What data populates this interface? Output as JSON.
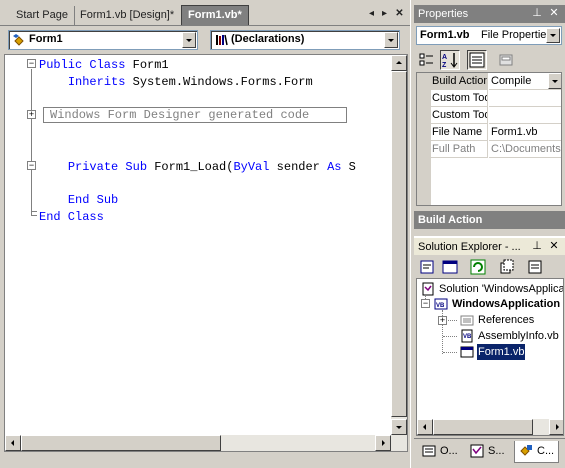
{
  "editor": {
    "tabs": [
      {
        "label": "Start Page",
        "active": false
      },
      {
        "label": "Form1.vb [Design]*",
        "active": false
      },
      {
        "label": "Form1.vb*",
        "active": true
      }
    ],
    "class_combo": "Form1",
    "method_combo": "(Declarations)",
    "code": {
      "line1": {
        "kw": "Public Class",
        "rest": " Form1"
      },
      "line2": {
        "kw": "Inherits",
        "rest": " System.Windows.Forms.Form"
      },
      "region": "Windows Form Designer generated code",
      "line4": {
        "kw1": "Private Sub",
        "mid": " Form1_Load(",
        "kw2": "ByVal",
        "mid2": " sender ",
        "kw3": "As",
        "tail": " S"
      },
      "line5": {
        "kw": "End Sub"
      },
      "line6": {
        "kw": "End Class"
      }
    },
    "keyword_color": "#0000ff"
  },
  "properties": {
    "title": "Properties",
    "object_name": "Form1.vb",
    "object_type": "File Propertie",
    "rows": [
      {
        "name": "Build Action",
        "value": "Compile",
        "selected": true,
        "disabled": false
      },
      {
        "name": "Custom Tool",
        "value": "",
        "selected": false,
        "disabled": false
      },
      {
        "name": "Custom Tool",
        "value": "",
        "selected": false,
        "disabled": false
      },
      {
        "name": "File Name",
        "value": "Form1.vb",
        "selected": false,
        "disabled": false
      },
      {
        "name": "Full Path",
        "value": "C:\\Documents a",
        "selected": false,
        "disabled": true
      }
    ],
    "description_title": "Build Action"
  },
  "solution_explorer": {
    "title": "Solution Explorer - ...",
    "nodes": {
      "solution": "Solution 'WindowsApplicat",
      "project": "WindowsApplication",
      "references": "References",
      "assembly": "AssemblyInfo.vb",
      "form": "Form1.vb"
    }
  },
  "bottom_tabs": [
    {
      "label": "O..."
    },
    {
      "label": "S..."
    },
    {
      "label": "C..."
    }
  ]
}
